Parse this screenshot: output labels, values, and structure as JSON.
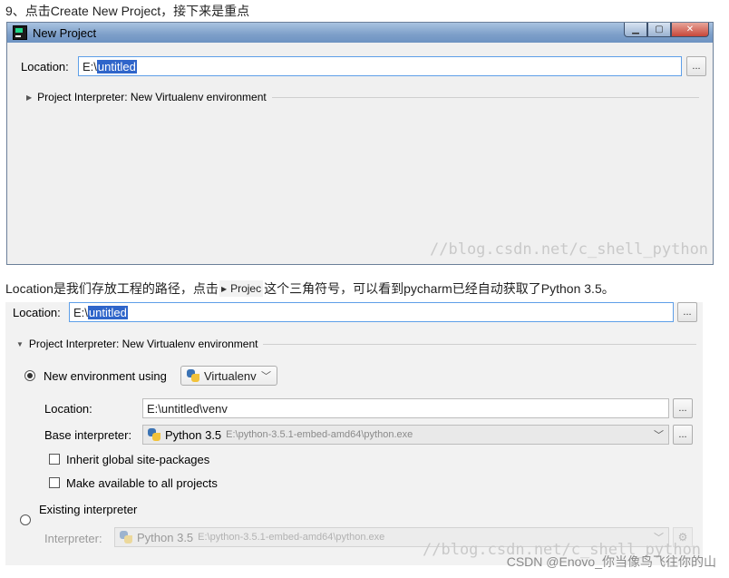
{
  "heading": "9、点击Create New Project，接下来是重点",
  "window": {
    "title": "New Project",
    "location_label": "Location:",
    "location_prefix": "E:\\",
    "location_selected": "untitled",
    "browse": "...",
    "section": "Project Interpreter: New Virtualenv environment",
    "watermark": "//blog.csdn.net/c_shell_python"
  },
  "caption": {
    "before": "Location是我们存放工程的路径，点击",
    "chip": "Projec",
    "after": "这个三角符号，可以看到pycharm已经自动获取了Python 3.5。"
  },
  "panel": {
    "location_label": "Location:",
    "location_prefix": "E:\\",
    "location_selected": "untitled",
    "browse": "...",
    "section": "Project Interpreter: New Virtualenv environment",
    "new_env_label": "New environment using",
    "env_tool": "Virtualenv",
    "venv_location_label": "Location:",
    "venv_location_value": "E:\\untitled\\venv",
    "base_label": "Base interpreter:",
    "base_python": "Python 3.5",
    "base_path": "E:\\python-3.5.1-embed-amd64\\python.exe",
    "inherit_label": "Inherit global site-packages",
    "make_available_label": "Make available to all projects",
    "existing_label": "Existing interpreter",
    "interpreter_label": "Interpreter:",
    "existing_python": "Python 3.5",
    "existing_path": "E:\\python-3.5.1-embed-amd64\\python.exe",
    "watermark": "//blog.csdn.net/c_shell_python"
  },
  "footer_credit": "CSDN @Enovo_你当像鸟飞往你的山"
}
